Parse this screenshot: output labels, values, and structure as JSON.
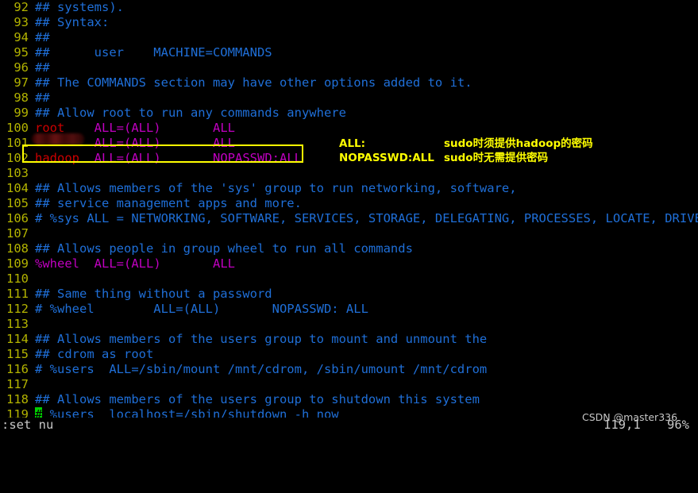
{
  "app": {
    "name": "vim",
    "file_type": "sudoers",
    "background": "#000000"
  },
  "colors": {
    "line_number": "#b3b300",
    "comment": "#1f6fd8",
    "username": "#cc0000",
    "keyword": "#c000c0",
    "highlight_box": "#ffff00",
    "annotation_text": "#ffff00",
    "cursor": "#00d000",
    "status_text": "#c8c8c8"
  },
  "editor": {
    "lines": [
      {
        "num": "92",
        "segments": [
          {
            "cls": "cmt",
            "text": "## systems)."
          }
        ]
      },
      {
        "num": "93",
        "segments": [
          {
            "cls": "cmt",
            "text": "## Syntax:"
          }
        ]
      },
      {
        "num": "94",
        "segments": [
          {
            "cls": "cmt",
            "text": "##"
          }
        ]
      },
      {
        "num": "95",
        "segments": [
          {
            "cls": "cmt",
            "text": "##      user    MACHINE=COMMANDS"
          }
        ]
      },
      {
        "num": "96",
        "segments": [
          {
            "cls": "cmt",
            "text": "##"
          }
        ]
      },
      {
        "num": "97",
        "segments": [
          {
            "cls": "cmt",
            "text": "## The COMMANDS section may have other options added to it."
          }
        ]
      },
      {
        "num": "98",
        "segments": [
          {
            "cls": "cmt",
            "text": "##"
          }
        ]
      },
      {
        "num": "99",
        "segments": [
          {
            "cls": "cmt",
            "text": "## Allow root to run any commands anywhere"
          }
        ]
      },
      {
        "num": "100",
        "segments": [
          {
            "cls": "usr",
            "text": "root"
          },
          {
            "cls": "plain",
            "text": "    "
          },
          {
            "cls": "spec",
            "text": "ALL=(ALL)"
          },
          {
            "cls": "plain",
            "text": "       "
          },
          {
            "cls": "spec",
            "text": "ALL"
          }
        ]
      },
      {
        "num": "101",
        "segments": [
          {
            "cls": "usr",
            "text": "        "
          },
          {
            "cls": "spec",
            "text": "ALL=(ALL)"
          },
          {
            "cls": "plain",
            "text": "       "
          },
          {
            "cls": "spec",
            "text": "ALL"
          }
        ]
      },
      {
        "num": "102",
        "segments": [
          {
            "cls": "usr",
            "text": "hadoop"
          },
          {
            "cls": "plain",
            "text": "  "
          },
          {
            "cls": "spec",
            "text": "ALL=(ALL)"
          },
          {
            "cls": "plain",
            "text": "       "
          },
          {
            "cls": "spec",
            "text": "NOPASSWD:ALL"
          }
        ]
      },
      {
        "num": "103",
        "segments": []
      },
      {
        "num": "104",
        "segments": [
          {
            "cls": "cmt",
            "text": "## Allows members of the 'sys' group to run networking, software,"
          }
        ]
      },
      {
        "num": "105",
        "segments": [
          {
            "cls": "cmt",
            "text": "## service management apps and more."
          }
        ]
      },
      {
        "num": "106",
        "segments": [
          {
            "cls": "cmt",
            "text": "# %sys ALL = NETWORKING, SOFTWARE, SERVICES, STORAGE, DELEGATING, PROCESSES, LOCATE, DRIVERS"
          }
        ]
      },
      {
        "num": "107",
        "segments": []
      },
      {
        "num": "108",
        "segments": [
          {
            "cls": "cmt",
            "text": "## Allows people in group wheel to run all commands"
          }
        ]
      },
      {
        "num": "109",
        "segments": [
          {
            "cls": "grp",
            "text": "%wheel"
          },
          {
            "cls": "plain",
            "text": "  "
          },
          {
            "cls": "spec",
            "text": "ALL=(ALL)"
          },
          {
            "cls": "plain",
            "text": "       "
          },
          {
            "cls": "spec",
            "text": "ALL"
          }
        ]
      },
      {
        "num": "110",
        "segments": []
      },
      {
        "num": "111",
        "segments": [
          {
            "cls": "cmt",
            "text": "## Same thing without a password"
          }
        ]
      },
      {
        "num": "112",
        "segments": [
          {
            "cls": "cmt",
            "text": "# %wheel        ALL=(ALL)       NOPASSWD: ALL"
          }
        ]
      },
      {
        "num": "113",
        "segments": []
      },
      {
        "num": "114",
        "segments": [
          {
            "cls": "cmt",
            "text": "## Allows members of the users group to mount and unmount the"
          }
        ]
      },
      {
        "num": "115",
        "segments": [
          {
            "cls": "cmt",
            "text": "## cdrom as root"
          }
        ]
      },
      {
        "num": "116",
        "segments": [
          {
            "cls": "cmt",
            "text": "# %users  ALL=/sbin/mount /mnt/cdrom, /sbin/umount /mnt/cdrom"
          }
        ]
      },
      {
        "num": "117",
        "segments": []
      },
      {
        "num": "118",
        "segments": [
          {
            "cls": "cmt",
            "text": "## Allows members of the users group to shutdown this system"
          }
        ]
      },
      {
        "num": "119",
        "segments": [
          {
            "cls": "cursor",
            "text": "#"
          },
          {
            "cls": "cmt",
            "text": " %users  localhost=/sbin/shutdown -h now"
          }
        ]
      }
    ]
  },
  "highlight": {
    "target_line": "102",
    "note": "yellow rectangle around hadoop sudoers entry"
  },
  "annotations": [
    {
      "key": "ALL:",
      "value": "sudo时须提供hadoop的密码"
    },
    {
      "key": "NOPASSWD:ALL",
      "value": "sudo时无需提供密码"
    }
  ],
  "status": {
    "command": ":set nu",
    "position": "119,1",
    "percent": "96%"
  },
  "watermark": {
    "text": "CSDN @master336"
  }
}
